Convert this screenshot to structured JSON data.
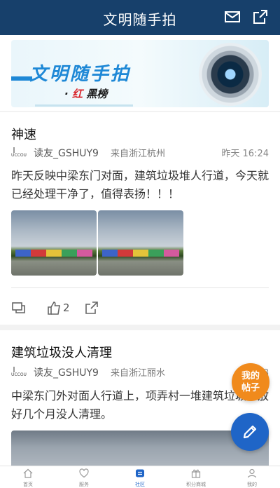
{
  "header": {
    "title": "文明随手拍"
  },
  "banner": {
    "title": "文明随手拍",
    "subtitle_dot": "·",
    "subtitle_red": "红",
    "subtitle_black": "黑榜"
  },
  "posts": [
    {
      "title": "神速",
      "author_logo": "UCCOU",
      "author": "读友_GSHUY9",
      "location": "来自浙江杭州",
      "time": "昨天 16:24",
      "body": "昨天反映中梁东门对面，建筑垃圾堆人行道，今天就已经处理干净了，值得表扬！！！",
      "likes": "2"
    },
    {
      "title": "建筑垃圾没人清理",
      "author_logo": "UCCOU",
      "author": "读友_GSHUY9",
      "location": "来自浙江丽水",
      "time": "8月8",
      "body": "中梁东门外对面人行道上，项弄村一堆建筑垃圾堆放好几个月没人清理。"
    }
  ],
  "fab": {
    "mine_line1": "我的",
    "mine_line2": "帖子"
  },
  "tabs": [
    {
      "label": "首页",
      "icon": "home-icon"
    },
    {
      "label": "服务",
      "icon": "heart-icon"
    },
    {
      "label": "社区",
      "icon": "community-icon"
    },
    {
      "label": "积分商城",
      "icon": "gift-icon"
    },
    {
      "label": "我的",
      "icon": "user-icon"
    }
  ],
  "colors": {
    "header": "#17406b",
    "accent": "#1f65c7",
    "fab_orange": "#f08a1c"
  }
}
